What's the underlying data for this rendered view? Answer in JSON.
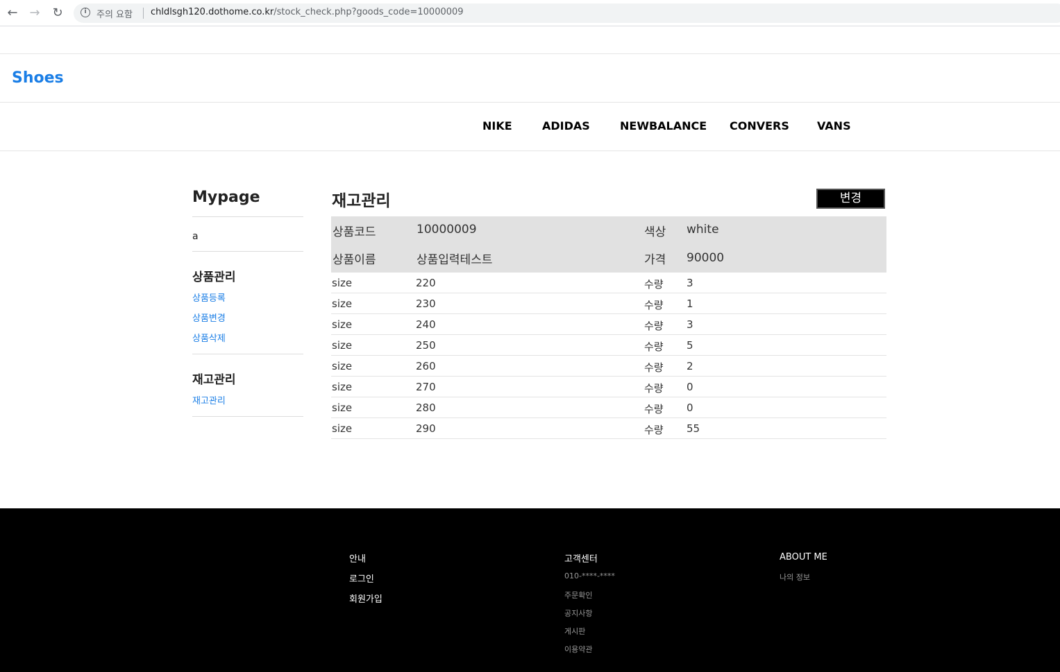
{
  "browser": {
    "security_warning": "주의 요함",
    "url_host": "chldlsgh120.dothome.co.kr",
    "url_path": "/stock_check.php?goods_code=10000009"
  },
  "header": {
    "logo": "Shoes",
    "menu": [
      "NIKE",
      "ADIDAS",
      "NEWBALANCE",
      "CONVERS",
      "VANS"
    ]
  },
  "sidebar": {
    "title": "Mypage",
    "user": "a",
    "section1_title": "상품관리",
    "section1_links": [
      "상품등록",
      "상품변경",
      "상품삭제"
    ],
    "section2_title": "재고관리",
    "section2_links": [
      "재고관리"
    ]
  },
  "main": {
    "title": "재고관리",
    "change_button": "변경",
    "info": {
      "code_label": "상품코드",
      "code_value": "10000009",
      "color_label": "색상",
      "color_value": "white",
      "name_label": "상품이름",
      "name_value": "상품입력테스트",
      "price_label": "가격",
      "price_value": "90000"
    },
    "size_label": "size",
    "qty_label": "수량",
    "stock": [
      {
        "size": "220",
        "qty": "3"
      },
      {
        "size": "230",
        "qty": "1"
      },
      {
        "size": "240",
        "qty": "3"
      },
      {
        "size": "250",
        "qty": "5"
      },
      {
        "size": "260",
        "qty": "2"
      },
      {
        "size": "270",
        "qty": "0"
      },
      {
        "size": "280",
        "qty": "0"
      },
      {
        "size": "290",
        "qty": "55"
      }
    ]
  },
  "footer": {
    "col1_title": "안내",
    "col1_links": [
      "로그인",
      "회원가입"
    ],
    "col2_title": "고객센터",
    "col2_links": [
      "010-****-****",
      "주문확인",
      "공지사항",
      "게시판",
      "이용약관"
    ],
    "col3_title": "ABOUT ME",
    "col3_links": [
      "나의 정보"
    ]
  },
  "colors": {
    "accent": "#1a7ee6",
    "info_bg": "#e1e1e1",
    "footer_bg": "#000000"
  }
}
